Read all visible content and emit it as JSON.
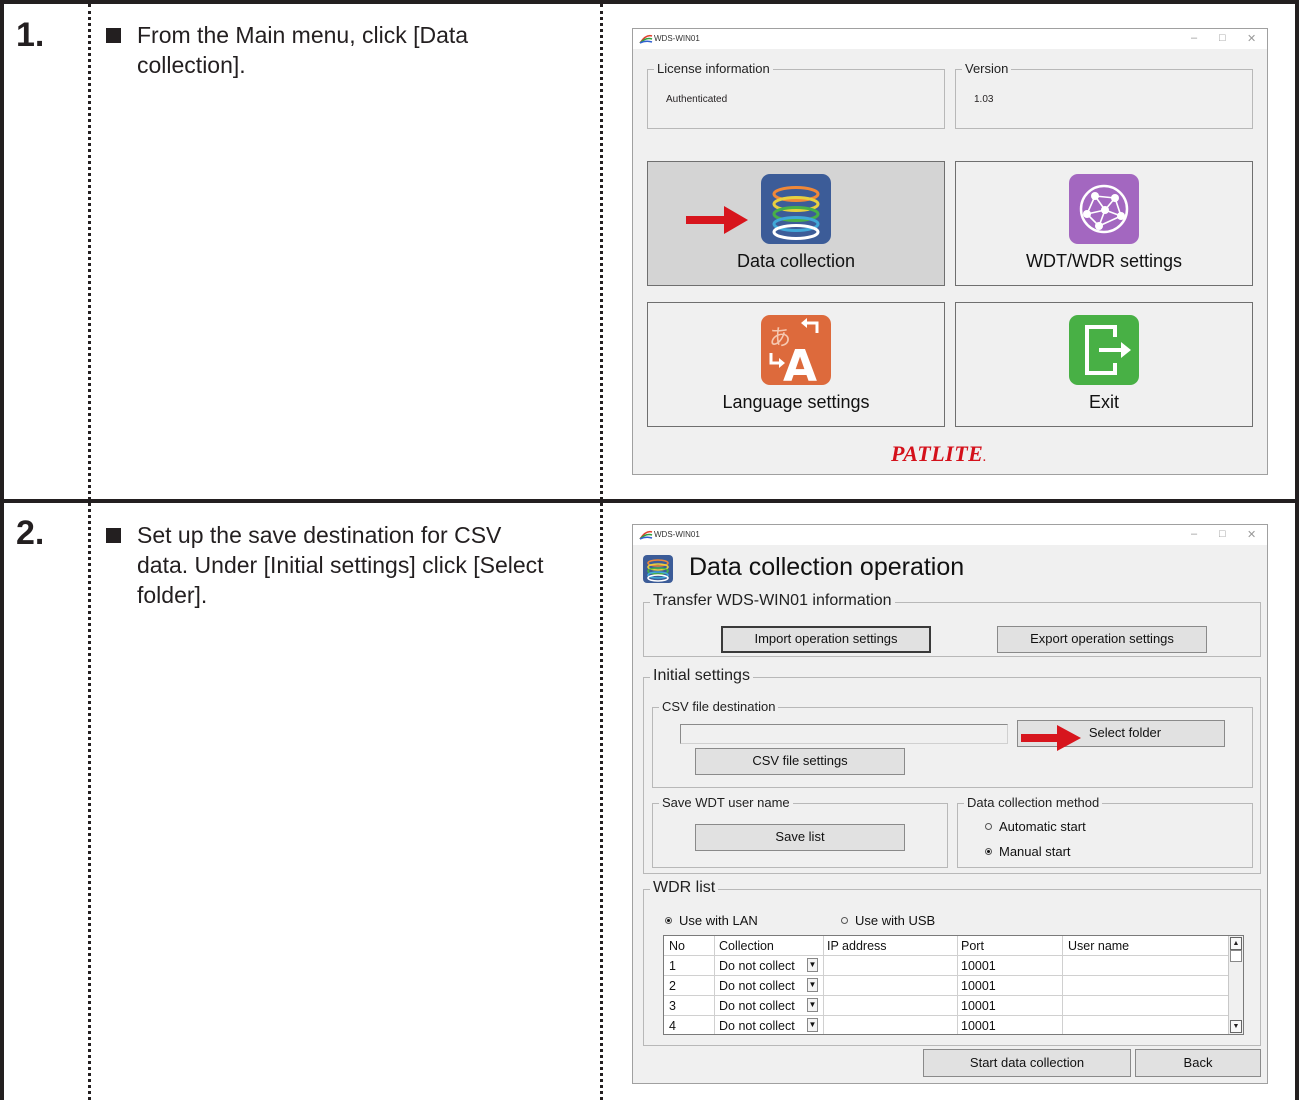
{
  "steps": [
    {
      "number": "1.",
      "instruction": "From the Main menu, click [Data collection].",
      "window": {
        "title": "WDS-WIN01",
        "license_group": {
          "label": "License information",
          "value": "Authenticated"
        },
        "version_group": {
          "label": "Version",
          "value": "1.03"
        },
        "buttons": [
          {
            "label": "Data collection",
            "icon": "data-collection-icon",
            "selected": true
          },
          {
            "label": "WDT/WDR settings",
            "icon": "network-globe-icon",
            "selected": false
          },
          {
            "label": "Language settings",
            "icon": "language-icon",
            "selected": false
          },
          {
            "label": "Exit",
            "icon": "exit-icon",
            "selected": false
          }
        ],
        "brand": "PATLITE",
        "brand_mark": "."
      }
    },
    {
      "number": "2.",
      "instruction": "Set up the save destination for CSV data. Under [Initial settings] click [Select folder].",
      "window": {
        "title": "WDS-WIN01",
        "heading": "Data collection operation",
        "transfer_group": {
          "label": "Transfer WDS-WIN01 information",
          "import_button": "Import operation settings",
          "export_button": "Export operation settings"
        },
        "initial_group": {
          "label": "Initial settings",
          "csv_group": {
            "label": "CSV file destination",
            "path_value": "",
            "select_button": "Select folder",
            "settings_button": "CSV file settings"
          },
          "save_group": {
            "label": "Save WDT user name",
            "save_button": "Save list"
          },
          "method_group": {
            "label": "Data collection method",
            "options": [
              {
                "label": "Automatic start",
                "checked": false
              },
              {
                "label": "Manual start",
                "checked": true
              }
            ]
          }
        },
        "wdr_group": {
          "label": "WDR list",
          "connection_options": [
            {
              "label": "Use with LAN",
              "checked": true
            },
            {
              "label": "Use with USB",
              "checked": false
            }
          ],
          "columns": [
            "No",
            "Collection",
            "IP address",
            "Port",
            "User name"
          ],
          "rows": [
            {
              "no": "1",
              "collection": "Do not collect",
              "ip": "",
              "port": "10001",
              "user": ""
            },
            {
              "no": "2",
              "collection": "Do not collect",
              "ip": "",
              "port": "10001",
              "user": ""
            },
            {
              "no": "3",
              "collection": "Do not collect",
              "ip": "",
              "port": "10001",
              "user": ""
            },
            {
              "no": "4",
              "collection": "Do not collect",
              "ip": "",
              "port": "10001",
              "user": ""
            }
          ]
        },
        "start_button": "Start data collection",
        "back_button": "Back"
      }
    }
  ],
  "colors": {
    "arrow": "#d7151d",
    "border": "#231f20",
    "window_bg": "#f0f0f0",
    "selected_button": "#d4d4d4"
  }
}
